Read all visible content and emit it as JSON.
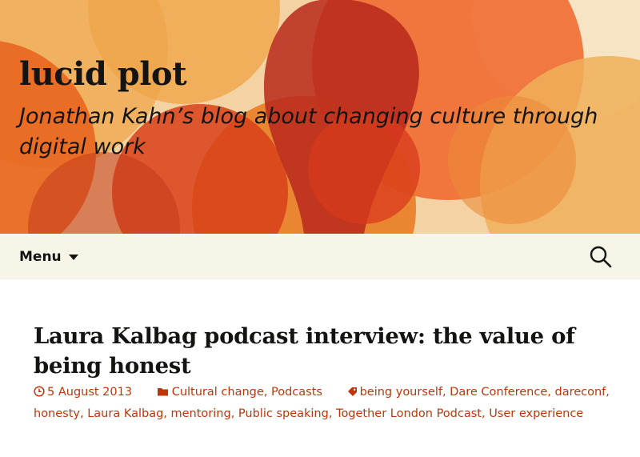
{
  "site": {
    "title": "lucid plot",
    "description": "Jonathan Kahn’s blog about changing culture through digital work"
  },
  "nav": {
    "menu_label": "Menu",
    "search_icon": "search-icon"
  },
  "post": {
    "title": "Laura Kalbag podcast interview: the value of being honest",
    "date": "5 August 2013",
    "categories": [
      "Cultural change",
      "Podcasts"
    ],
    "tags": [
      "being yourself",
      "Dare Conference",
      "dareconf",
      "honesty",
      "Laura Kalbag",
      "mentoring",
      "Public speaking",
      "Together London Podcast",
      "User experience"
    ]
  },
  "colors": {
    "link": "#bc360a",
    "navbar_bg": "#f7f5e7",
    "header_base": "#f4cf9a"
  }
}
